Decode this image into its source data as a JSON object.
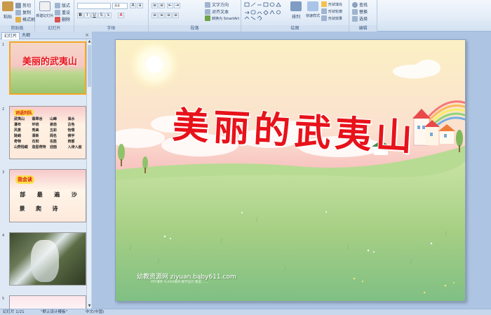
{
  "ribbon": {
    "clipboard": {
      "label": "剪贴板",
      "paste": "粘贴",
      "cut": "剪切",
      "copy": "复制",
      "format": "格式刷"
    },
    "slides": {
      "label": "幻灯片",
      "new_slide": "新建幻灯片",
      "layout": "版式",
      "reset": "重设",
      "delete": "删除"
    },
    "font": {
      "label": "字体",
      "font_name": "",
      "font_size": "44"
    },
    "paragraph": {
      "label": "段落",
      "text_direction": "文字方向",
      "align_text": "对齐文本",
      "smartart": "转换为 SmartArt"
    },
    "drawing": {
      "label": "绘图",
      "arrange": "排列",
      "quick_styles": "快速样式",
      "shape_fill": "形状填充",
      "shape_outline": "形状轮廓",
      "shape_effects": "形状效果"
    },
    "editing": {
      "label": "编辑",
      "find": "查找",
      "replace": "替换",
      "select": "选择"
    }
  },
  "left_panel": {
    "tab_slides": "幻灯片",
    "tab_outline": "大纲",
    "close": "×",
    "slides": [
      {
        "num": "1",
        "title": "美丽的武夷山"
      },
      {
        "num": "2",
        "title": "词语列队",
        "words": [
          "武夷山",
          "翡翠谷",
          "山峰",
          "溪水",
          "瀑布",
          "环绕",
          "姿态",
          "古色",
          "风景",
          "秀美",
          "五彩",
          "怡情",
          "陡峭",
          "清新",
          "闻名",
          "佛宇",
          "奇特",
          "石刻",
          "名胜",
          "西部",
          "山势险峻",
          "造型奇特",
          "迎面",
          "入诗入画"
        ]
      },
      {
        "num": "3",
        "title": "我会读",
        "row1": [
          "部",
          "最",
          "遍",
          "沙"
        ],
        "row2": [
          "景",
          "爬",
          "诗"
        ]
      },
      {
        "num": "4"
      },
      {
        "num": "5"
      }
    ]
  },
  "slide": {
    "title": "美丽的武夷山",
    "watermark": "幼教资源网 ziyuan.baby611.com",
    "watermark_sub": "PPT课件 FLASH课件 教学设计 教案 ……"
  },
  "status_bar": {
    "slide_info": "幻灯片 1/21",
    "theme": "\"默认设计模板\"",
    "language": "中文(中国)"
  },
  "colors": {
    "title_red": "#e8121a",
    "ribbon_bg": "#dfe9f5",
    "selection": "#f5a623"
  }
}
